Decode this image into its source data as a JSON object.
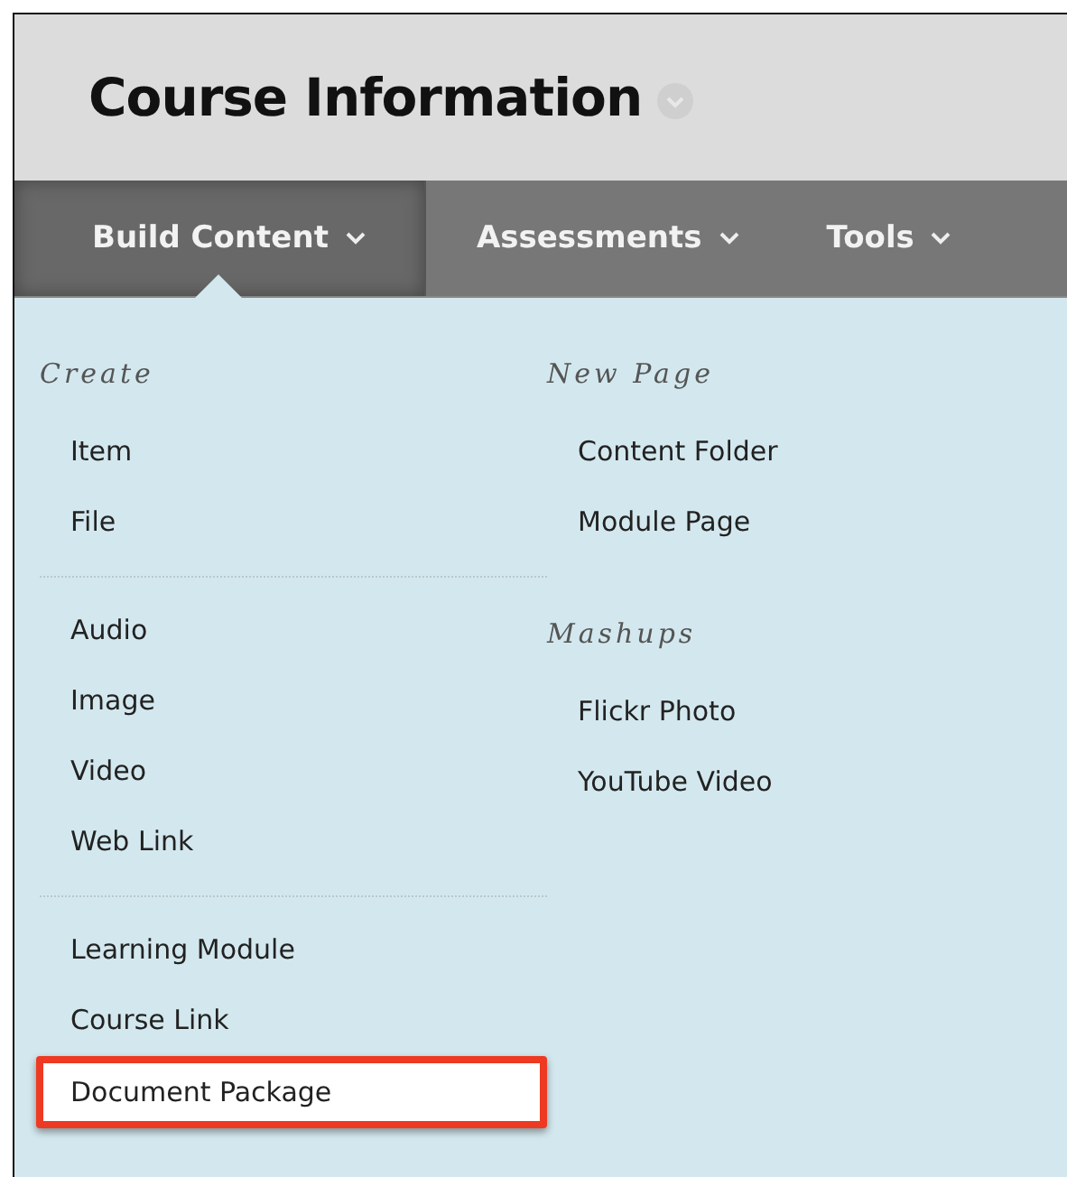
{
  "page_title": "Course Information",
  "tabs": [
    {
      "label": "Build Content",
      "selected": true
    },
    {
      "label": "Assessments",
      "selected": false
    },
    {
      "label": "Tools",
      "selected": false
    }
  ],
  "menu_columns": [
    {
      "sections": [
        {
          "heading": "Create",
          "groups": [
            [
              {
                "label": "Item",
                "highlighted": false
              },
              {
                "label": "File",
                "highlighted": false
              }
            ],
            [
              {
                "label": "Audio",
                "highlighted": false
              },
              {
                "label": "Image",
                "highlighted": false
              },
              {
                "label": "Video",
                "highlighted": false
              },
              {
                "label": "Web Link",
                "highlighted": false
              }
            ],
            [
              {
                "label": "Learning Module",
                "highlighted": false
              },
              {
                "label": "Course Link",
                "highlighted": false
              },
              {
                "label": "Document Package",
                "highlighted": true
              }
            ]
          ]
        }
      ]
    },
    {
      "sections": [
        {
          "heading": "New Page",
          "groups": [
            [
              {
                "label": "Content Folder",
                "highlighted": false
              },
              {
                "label": "Module Page",
                "highlighted": false
              }
            ]
          ]
        },
        {
          "heading": "Mashups",
          "groups": [
            [
              {
                "label": "Flickr Photo",
                "highlighted": false
              },
              {
                "label": "YouTube Video",
                "highlighted": false
              }
            ]
          ]
        }
      ]
    }
  ]
}
